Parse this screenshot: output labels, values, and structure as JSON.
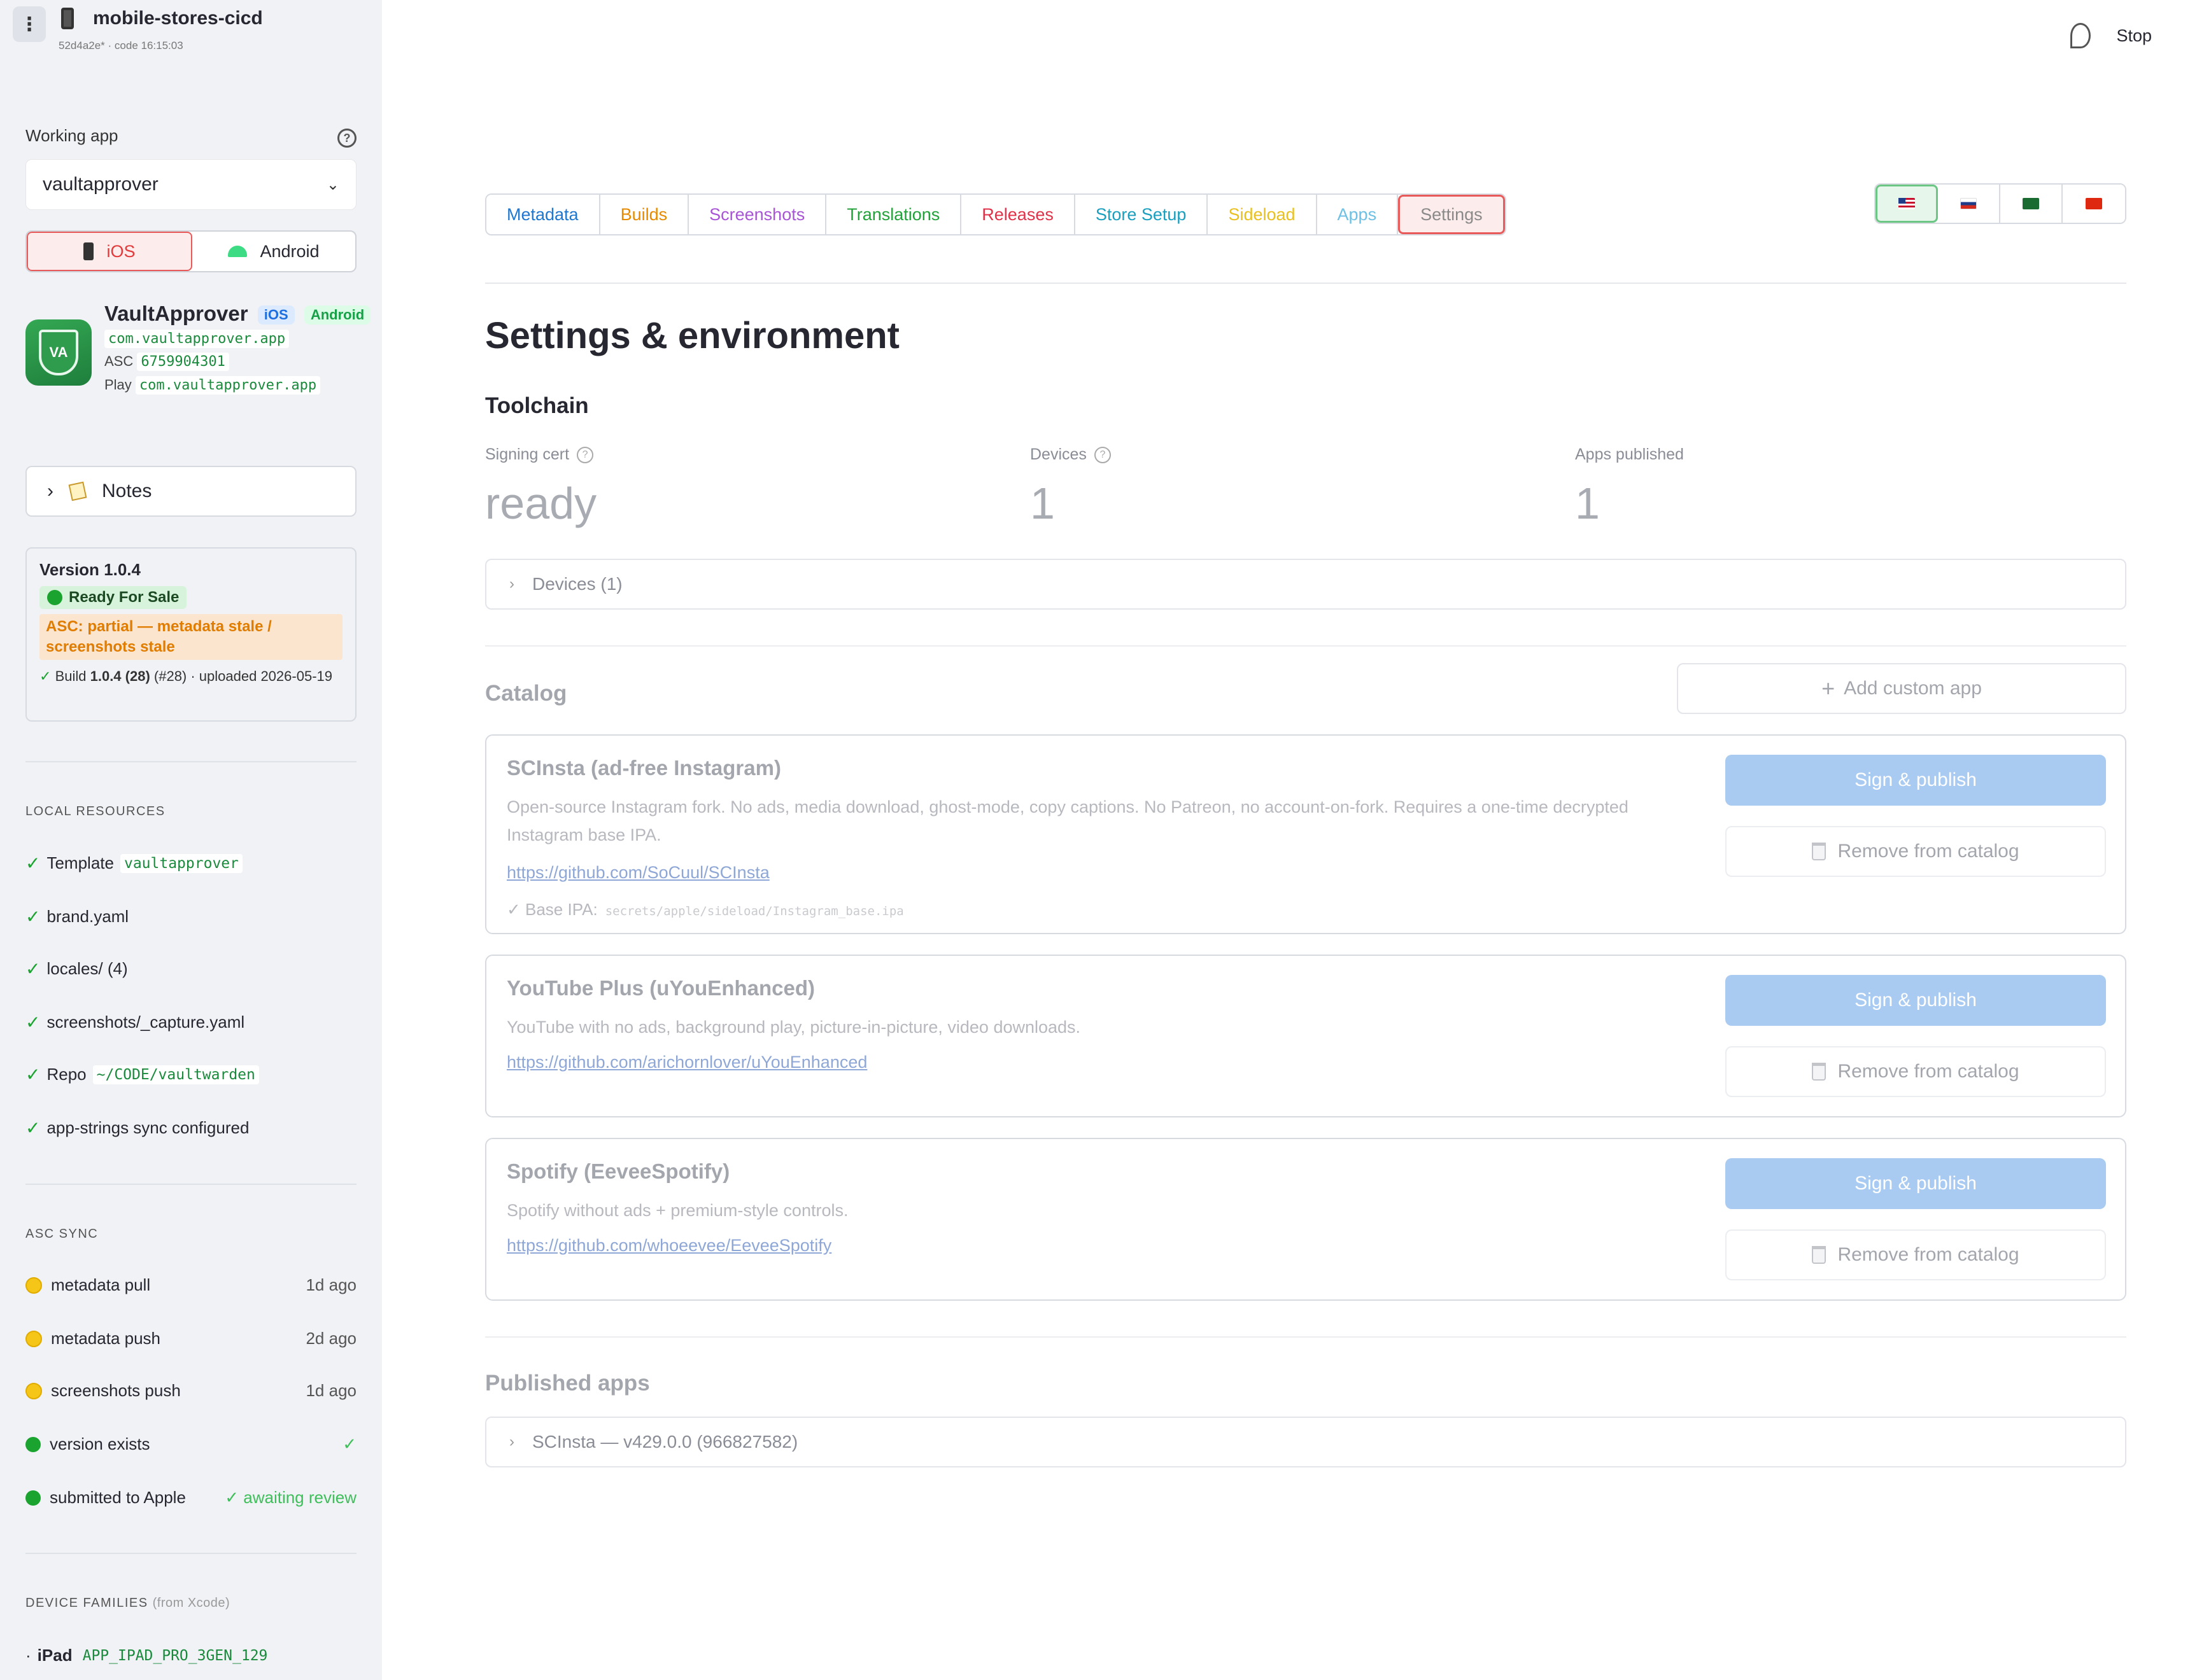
{
  "header": {
    "app_name": "mobile-stores-cicd",
    "subtitle": "52d4a2e* · code 16:15:03",
    "stop_label": "Stop"
  },
  "sidebar": {
    "working_label": "Working app",
    "selected_app": "vaultapprover",
    "platforms": [
      {
        "label": "iOS",
        "active": true
      },
      {
        "label": "Android",
        "active": false
      }
    ],
    "app_card": {
      "icon_text": "VA",
      "name": "VaultApprover",
      "badge_ios": "iOS",
      "badge_android": "Android",
      "bundle_id": "com.vaultapprover.app",
      "asc_label": "ASC",
      "asc_id": "6759904301",
      "play_label": "Play",
      "play_id": "com.vaultapprover.app"
    },
    "notes_label": "Notes",
    "version": {
      "title": "Version 1.0.4",
      "status": "Ready For Sale",
      "asc_warning": "ASC: partial — metadata stale / screenshots stale",
      "build_prefix": "Build ",
      "build_version": "1.0.4 (28)",
      "build_suffix": " (#28) · uploaded 2026-05-19"
    },
    "local_resources": {
      "heading": "LOCAL RESOURCES",
      "items": [
        {
          "label": "Template",
          "code": "vaultapprover"
        },
        {
          "label": "brand.yaml",
          "code": ""
        },
        {
          "label": "locales/ (4)",
          "code": ""
        },
        {
          "label": "screenshots/_capture.yaml",
          "code": ""
        },
        {
          "label": "Repo",
          "code": "~/CODE/vaultwarden"
        },
        {
          "label": "app-strings sync configured",
          "code": ""
        }
      ]
    },
    "asc_sync": {
      "heading": "ASC SYNC",
      "items": [
        {
          "label": "metadata pull",
          "status": "1d ago",
          "dot": "yellow"
        },
        {
          "label": "metadata push",
          "status": "2d ago",
          "dot": "yellow"
        },
        {
          "label": "screenshots push",
          "status": "1d ago",
          "dot": "yellow"
        },
        {
          "label": "version exists",
          "status": "✓",
          "dot": "green"
        },
        {
          "label": "submitted to Apple",
          "status": "✓ awaiting review",
          "dot": "green"
        }
      ]
    },
    "device_families": {
      "heading": "DEVICE FAMILIES",
      "heading_note": "(from Xcode)",
      "items": [
        {
          "label": "iPad",
          "code": "APP_IPAD_PRO_3GEN_129"
        }
      ]
    }
  },
  "tabs": [
    {
      "label": "Metadata",
      "color": "#1f77d0",
      "active": false
    },
    {
      "label": "Builds",
      "color": "#e68a00",
      "active": false
    },
    {
      "label": "Screenshots",
      "color": "#a855d6",
      "active": false
    },
    {
      "label": "Translations",
      "color": "#22a33a",
      "active": false
    },
    {
      "label": "Releases",
      "color": "#e0334a",
      "active": false
    },
    {
      "label": "Store Setup",
      "color": "#1a9fbf",
      "active": false
    },
    {
      "label": "Sideload",
      "color": "#e8c020",
      "active": false
    },
    {
      "label": "Apps",
      "color": "#6ec1e4",
      "active": false
    },
    {
      "label": "Settings",
      "color": "#8a8a8a",
      "active": true
    }
  ],
  "languages": [
    {
      "flag": "us",
      "active": true
    },
    {
      "flag": "ru",
      "active": false
    },
    {
      "flag": "sa",
      "active": false
    },
    {
      "flag": "cn",
      "active": false
    }
  ],
  "main": {
    "page_title": "Settings & environment",
    "toolchain_title": "Toolchain",
    "metrics": [
      {
        "label": "Signing cert",
        "value": "ready",
        "help": true
      },
      {
        "label": "Devices",
        "value": "1",
        "help": true
      },
      {
        "label": "Apps published",
        "value": "1",
        "help": false
      }
    ],
    "devices_expander": "Devices (1)",
    "catalog_title": "Catalog",
    "add_custom_label": "Add custom app",
    "catalog": [
      {
        "name": "SCInsta (ad-free Instagram)",
        "description": "Open-source Instagram fork. No ads, media download, ghost-mode, copy captions. No Patreon, no account-on-fork. Requires a one-time decrypted Instagram base IPA.",
        "link": "https://github.com/SoCuul/SCInsta",
        "base_label": "✓ Base IPA:",
        "base_path": "secrets/apple/sideload/Instagram_base.ipa",
        "publish_label": "Sign & publish",
        "remove_label": "Remove from catalog"
      },
      {
        "name": "YouTube Plus (uYouEnhanced)",
        "description": "YouTube with no ads, background play, picture-in-picture, video downloads.",
        "link": "https://github.com/arichornlover/uYouEnhanced",
        "publish_label": "Sign & publish",
        "remove_label": "Remove from catalog"
      },
      {
        "name": "Spotify (EeveeSpotify)",
        "description": "Spotify without ads + premium-style controls.",
        "link": "https://github.com/whoeevee/EeveeSpotify",
        "publish_label": "Sign & publish",
        "remove_label": "Remove from catalog"
      }
    ],
    "published_title": "Published apps",
    "published_expander": "SCInsta — v429.0.0 (966827582)"
  }
}
